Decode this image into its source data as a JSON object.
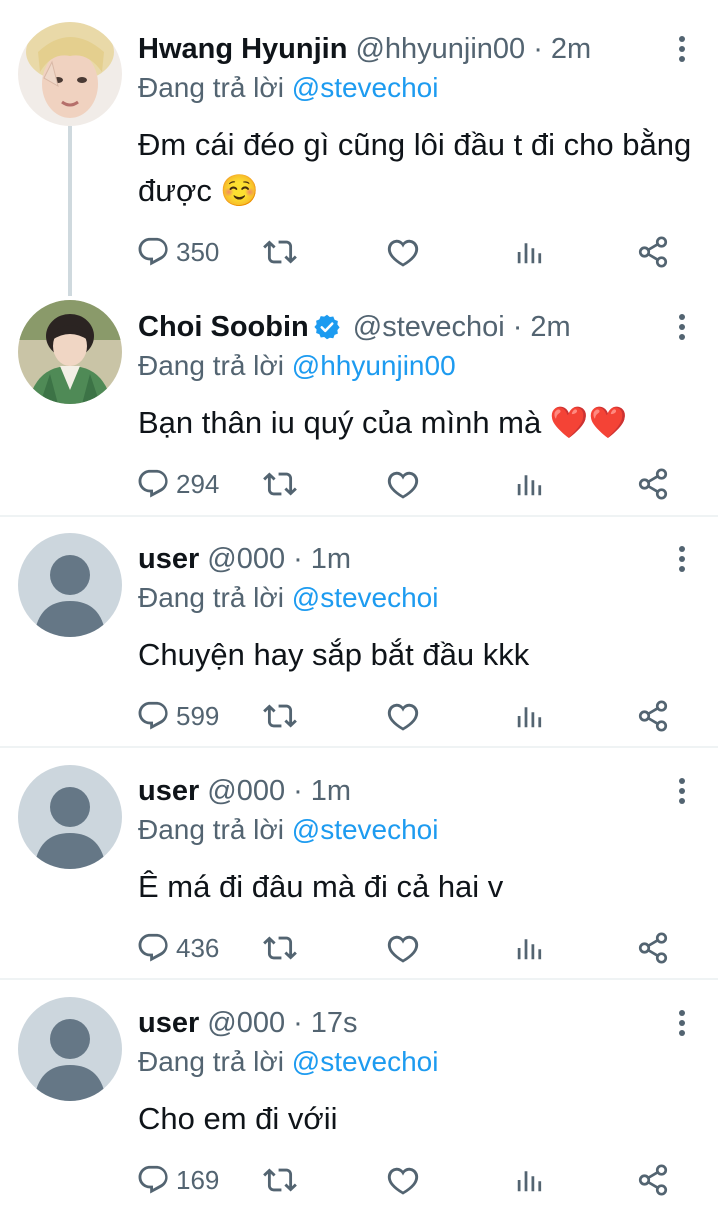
{
  "colors": {
    "accent": "#1d9bf0",
    "secondary_text": "#536471",
    "divider": "#eff3f4",
    "heart": "#e0245e"
  },
  "tweets": [
    {
      "name": "Hwang Hyunjin",
      "handle": "@hhyunjin00",
      "separator": "·",
      "time": "2m",
      "verified": false,
      "replying_prefix": "Đang trả lời",
      "replying_to": "@stevechoi",
      "text": "Đm cái đéo gì cũng lôi đầu t đi cho bằng được ☺️",
      "reply_count": "350",
      "avatar": "photo-light-hair"
    },
    {
      "name": "Choi Soobin",
      "handle": "@stevechoi",
      "separator": "·",
      "time": "2m",
      "verified": true,
      "replying_prefix": "Đang trả lời",
      "replying_to": "@hhyunjin00",
      "text": "Bạn thân iu quý của mình mà ❤️❤️",
      "reply_count": "294",
      "avatar": "photo-green-jacket"
    },
    {
      "name": "user",
      "handle": "@000",
      "separator": "·",
      "time": "1m",
      "verified": false,
      "replying_prefix": "Đang trả lời",
      "replying_to": "@stevechoi",
      "text": "Chuyện hay sắp bắt đầu kkk",
      "reply_count": "599",
      "avatar": "default-avatar"
    },
    {
      "name": "user",
      "handle": "@000",
      "separator": "·",
      "time": "1m",
      "verified": false,
      "replying_prefix": "Đang trả lời",
      "replying_to": "@stevechoi",
      "text": "Ê má đi đâu mà đi cả hai v",
      "reply_count": "436",
      "avatar": "default-avatar"
    },
    {
      "name": "user",
      "handle": "@000",
      "separator": "·",
      "time": "17s",
      "verified": false,
      "replying_prefix": "Đang trả lời",
      "replying_to": "@stevechoi",
      "text": "Cho em đi vớii",
      "reply_count": "169",
      "avatar": "default-avatar"
    }
  ],
  "icons": {
    "reply": "reply-icon",
    "retweet": "retweet-icon",
    "like": "heart-icon",
    "views": "analytics-icon",
    "share": "share-icon",
    "more": "more-options-icon",
    "verified": "verified-badge-icon"
  }
}
